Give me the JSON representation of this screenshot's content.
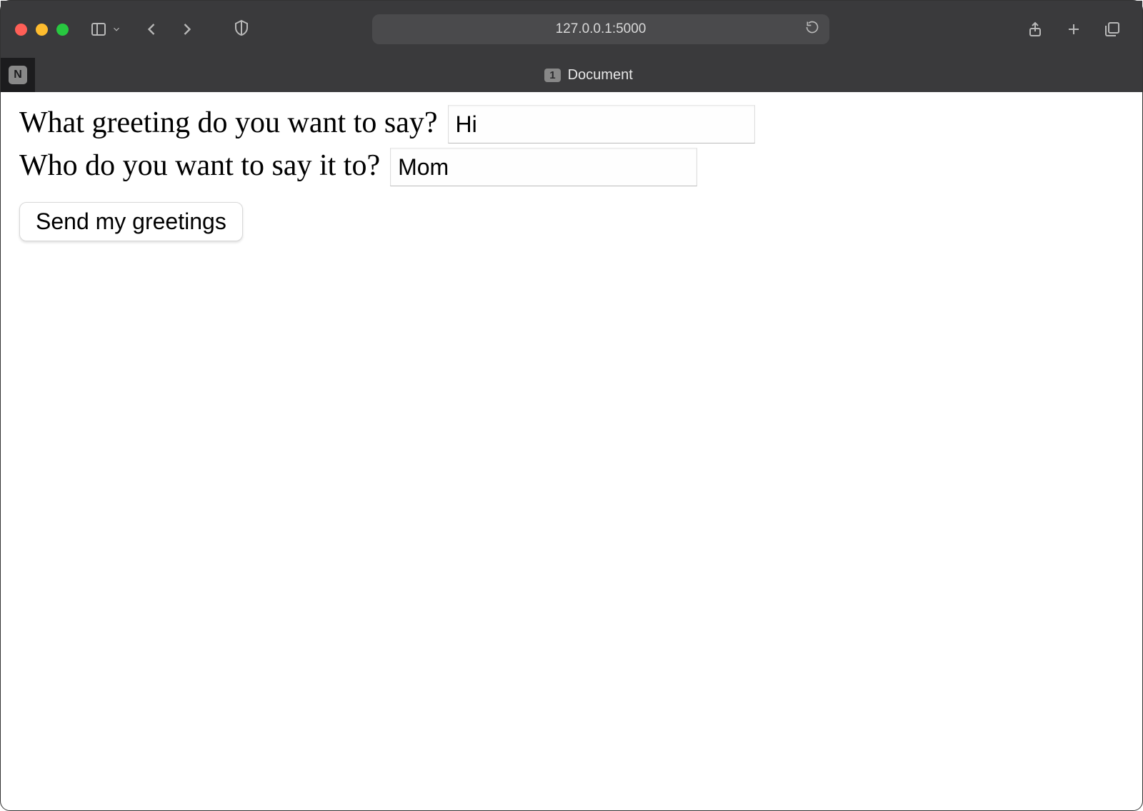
{
  "browser": {
    "url": "127.0.0.1:5000",
    "tab": {
      "badge": "1",
      "title": "Document",
      "favicon_letter": "N"
    }
  },
  "form": {
    "greeting": {
      "label": "What greeting do you want to say?",
      "value": "Hi"
    },
    "recipient": {
      "label": "Who do you want to say it to?",
      "value": "Mom"
    },
    "submit_label": "Send my greetings"
  }
}
